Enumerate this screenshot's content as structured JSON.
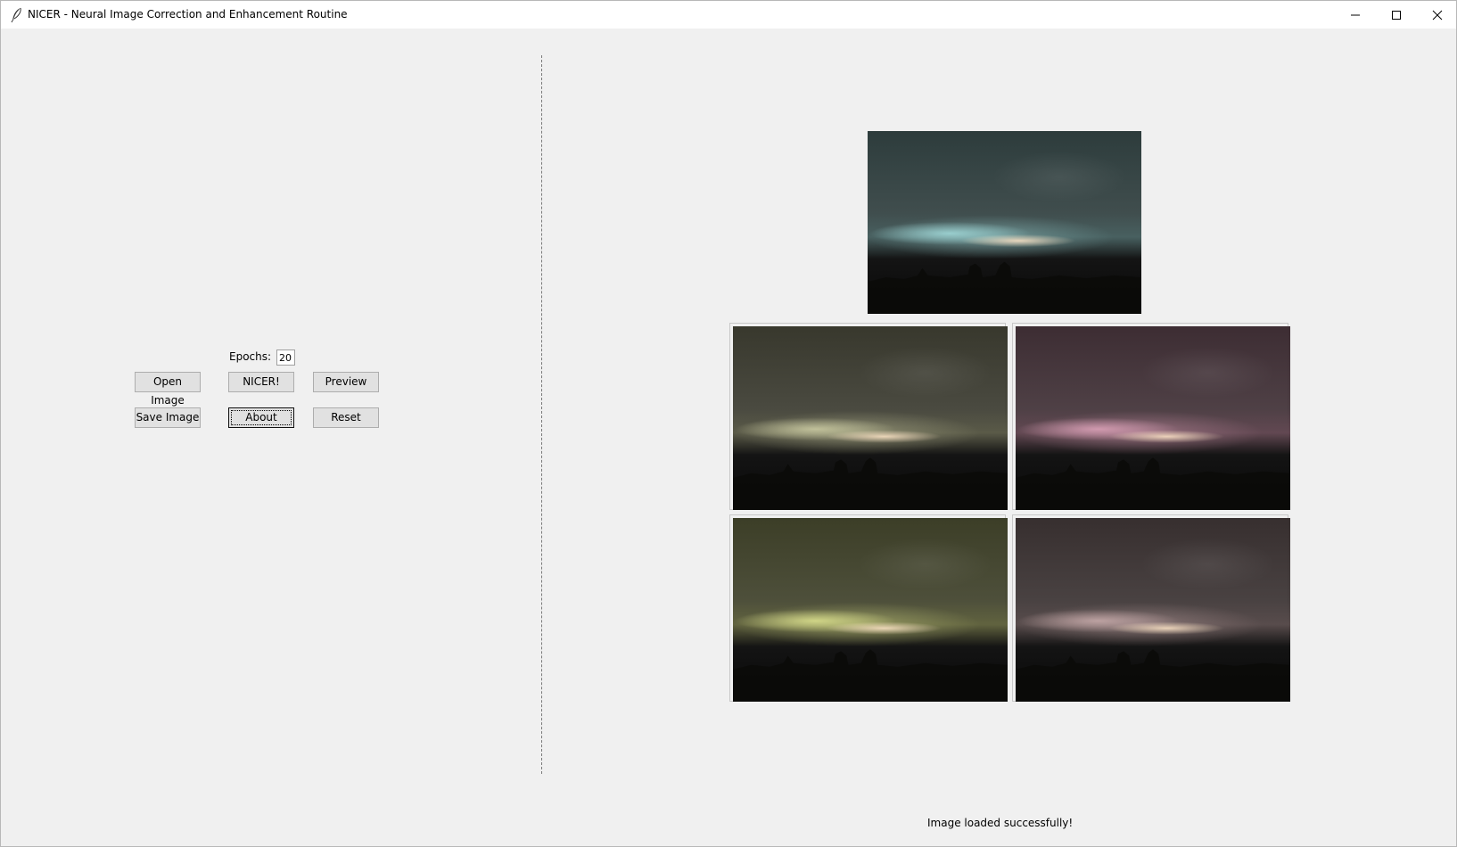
{
  "window": {
    "title": "NICER - Neural Image Correction and Enhancement Routine",
    "app_icon": "feather-icon"
  },
  "controls": {
    "epochs_label": "Epochs:",
    "epochs_value": "20",
    "open_image_label": "Open Image",
    "nicer_label": "NICER!",
    "preview_label": "Preview",
    "save_image_label": "Save Image",
    "about_label": "About",
    "reset_label": "Reset"
  },
  "images": {
    "main_tint": "#9fd6d6",
    "variants": [
      {
        "tint": "#c8c8a0"
      },
      {
        "tint": "#d9a0b6"
      },
      {
        "tint": "#d8dd8c"
      },
      {
        "tint": "#c4a8a8"
      }
    ]
  },
  "status": {
    "message": "Image loaded successfully!"
  }
}
